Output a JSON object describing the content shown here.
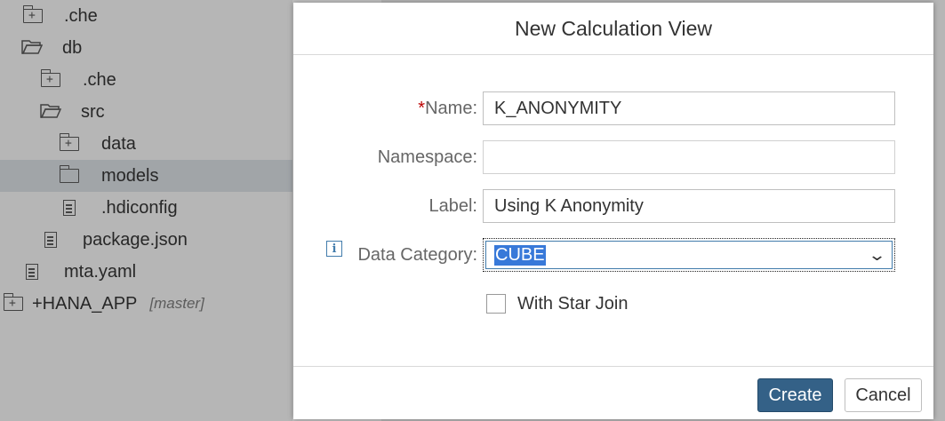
{
  "tree": {
    "items": [
      {
        "label": ".che",
        "icon": "folder-plus-icon"
      },
      {
        "label": "db",
        "icon": "folder-open-icon"
      },
      {
        "label": ".che",
        "icon": "folder-plus-icon"
      },
      {
        "label": "src",
        "icon": "folder-open-icon"
      },
      {
        "label": "data",
        "icon": "folder-plus-icon"
      },
      {
        "label": "models",
        "icon": "folder-icon"
      },
      {
        "label": ".hdiconfig",
        "icon": "file-icon"
      },
      {
        "label": "package.json",
        "icon": "file-icon"
      },
      {
        "label": "mta.yaml",
        "icon": "file-icon"
      },
      {
        "label": "+HANA_APP",
        "icon": "folder-plus-icon",
        "branch": "[master]"
      }
    ]
  },
  "dialog": {
    "title": "New Calculation View",
    "name_label": "Name:",
    "name_required": "*",
    "name_value": "K_ANONYMITY",
    "namespace_label": "Namespace:",
    "namespace_value": "",
    "label_label": "Label:",
    "label_value": "Using K Anonymity",
    "category_label": "Data Category:",
    "category_value": "CUBE",
    "star_join_label": "With Star Join",
    "star_join_checked": false,
    "create_label": "Create",
    "cancel_label": "Cancel"
  },
  "colors": {
    "primary_button": "#346187",
    "required": "#bb0000",
    "selection": "#3879d9"
  }
}
